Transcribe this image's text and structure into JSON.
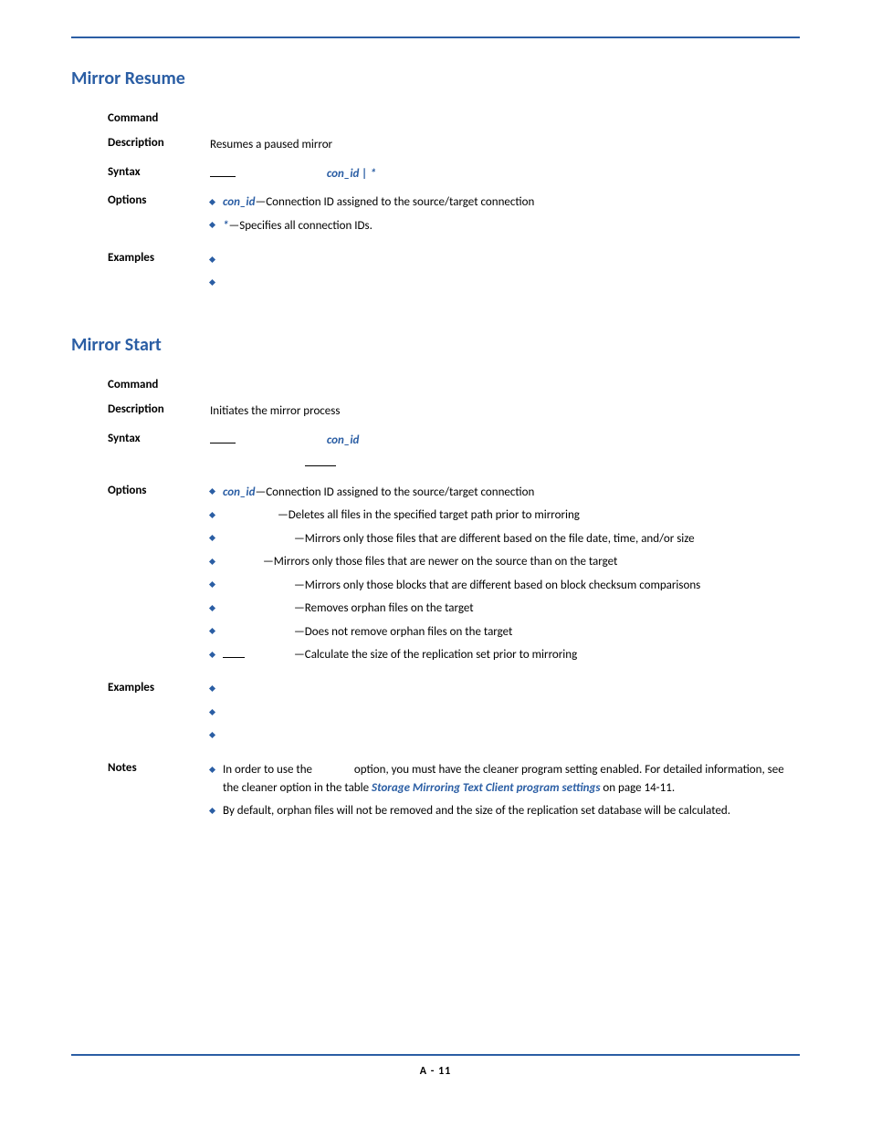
{
  "section1": {
    "heading": "Mirror Resume",
    "rows": {
      "command_label": "Command",
      "description_label": "Description",
      "description_text": "Resumes a paused mirror",
      "syntax_label": "Syntax",
      "syntax_params": "con_id | *",
      "options_label": "Options",
      "options": [
        {
          "term": "con_id",
          "desc": "—Connection ID assigned to the source/target connection"
        },
        {
          "term": "*",
          "desc": "—Specifies all connection IDs."
        }
      ],
      "examples_label": "Examples"
    }
  },
  "section2": {
    "heading": "Mirror Start",
    "rows": {
      "command_label": "Command",
      "description_label": "Description",
      "description_text": "Initiates the mirror process",
      "syntax_label": "Syntax",
      "syntax_params": "con_id",
      "options_label": "Options",
      "options": {
        "con_id": {
          "term": "con_id",
          "desc": "—Connection ID assigned to the source/target connection"
        },
        "o1": "—Deletes all files in the specified target path prior to mirroring",
        "o2": "—Mirrors only those files that are different based on the file date, time, and/or size",
        "o3": "—Mirrors only those files that are newer on the source than on the target",
        "o4": "—Mirrors only those blocks that are different based on block checksum comparisons",
        "o5": "—Removes orphan files on the target",
        "o6": "—Does not remove orphan files on the target",
        "o7": "—Calculate the size of the replication set prior to mirroring"
      },
      "examples_label": "Examples",
      "notes_label": "Notes",
      "notes": {
        "n1_pre": "In order to use the ",
        "n1_post": " option, you must have the cleaner program setting enabled. For detailed information, see the cleaner option in the table ",
        "n1_link": "Storage Mirroring Text Client program settings",
        "n1_after": " on page 14-11.",
        "n2": "By default, orphan files will not be removed and the size of the replication set database will be calculated."
      }
    }
  },
  "footer": "A - 11"
}
